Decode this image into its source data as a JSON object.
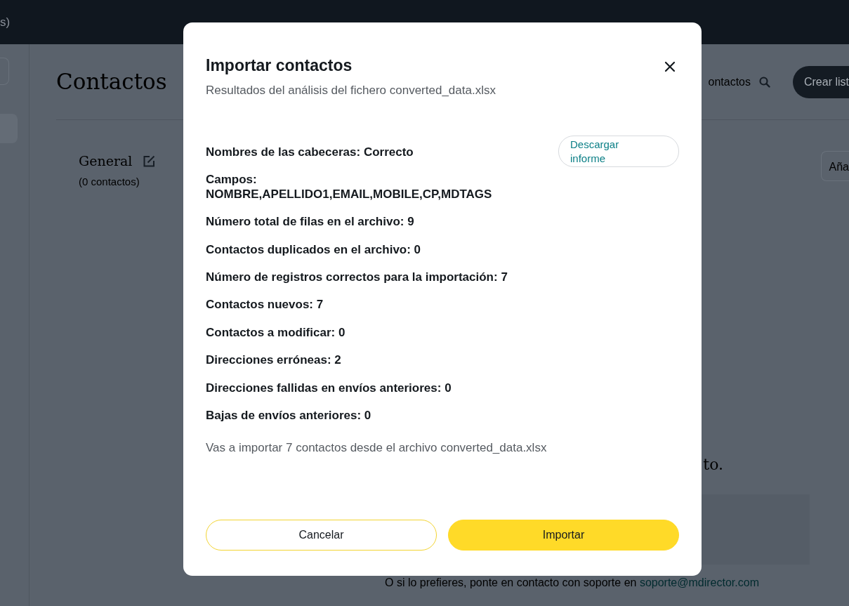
{
  "top_bar": {
    "text": "s)"
  },
  "page": {
    "title": "Contactos",
    "search_label": "ontactos",
    "create_button": "Crear list",
    "list": {
      "name": "General",
      "count": "(0 contactos)"
    },
    "add_button": "Aña",
    "empty_text": "to.",
    "support": {
      "text": "O si lo prefieres, ponte en contacto con soporte en",
      "link": "soporte@mdirector.com"
    }
  },
  "modal": {
    "title": "Importar contactos",
    "subtitle": "Resultados del análisis del fichero converted_data.xlsx",
    "download_button": "Descargar informe",
    "results": [
      {
        "text": "Nombres de las cabeceras: Correcto"
      },
      {
        "text": "Campos: NOMBRE,APELLIDO1,EMAIL,MOBILE,CP,MDTAGS"
      },
      {
        "text": "Número total de filas en el archivo: 9"
      },
      {
        "text": "Contactos duplicados en el archivo: 0"
      },
      {
        "text": "Número de registros correctos para la importación: 7"
      },
      {
        "text": "Contactos nuevos: 7"
      },
      {
        "text": "Contactos a modificar: 0"
      },
      {
        "text": "Direcciones erróneas: 2"
      },
      {
        "text": "Direcciones fallidas en envíos anteriores: 0"
      },
      {
        "text": "Bajas de envíos anteriores: 0"
      }
    ],
    "summary": "Vas a importar 7 contactos desde el archivo converted_data.xlsx",
    "buttons": [
      {
        "label": "Cancelar",
        "kind": "secondary"
      },
      {
        "label": "Importar",
        "kind": "primary"
      }
    ]
  }
}
